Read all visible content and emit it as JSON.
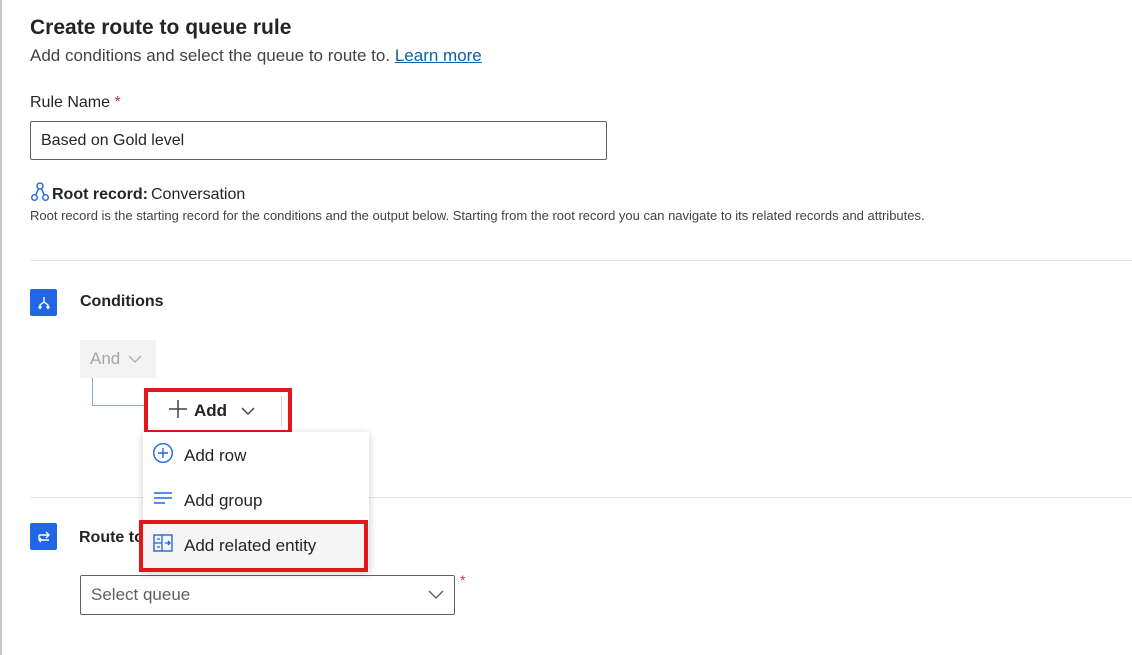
{
  "header": {
    "title": "Create route to queue rule",
    "subtitle": "Add conditions and select the queue to route to.",
    "learn_more": "Learn more"
  },
  "rule_name": {
    "label": "Rule Name",
    "required_mark": "*",
    "value": "Based on Gold level"
  },
  "root_record": {
    "label": "Root record:",
    "value": "Conversation",
    "description": "Root record is the starting record for the conditions and the output below. Starting from the root record you can navigate to its related records and attributes."
  },
  "conditions": {
    "label": "Conditions",
    "operator": "And",
    "add_label": "Add"
  },
  "add_menu": {
    "items": [
      {
        "label": "Add row",
        "icon": "plus-circle-icon"
      },
      {
        "label": "Add group",
        "icon": "group-lines-icon"
      },
      {
        "label": "Add related entity",
        "icon": "related-entity-icon"
      }
    ]
  },
  "route": {
    "label": "Route to",
    "queue_placeholder": "Select queue",
    "required_mark": "*"
  },
  "colors": {
    "accent": "#2266e3",
    "link": "#115ea3",
    "highlight_border": "#e3161c",
    "required": "#c4314b"
  }
}
